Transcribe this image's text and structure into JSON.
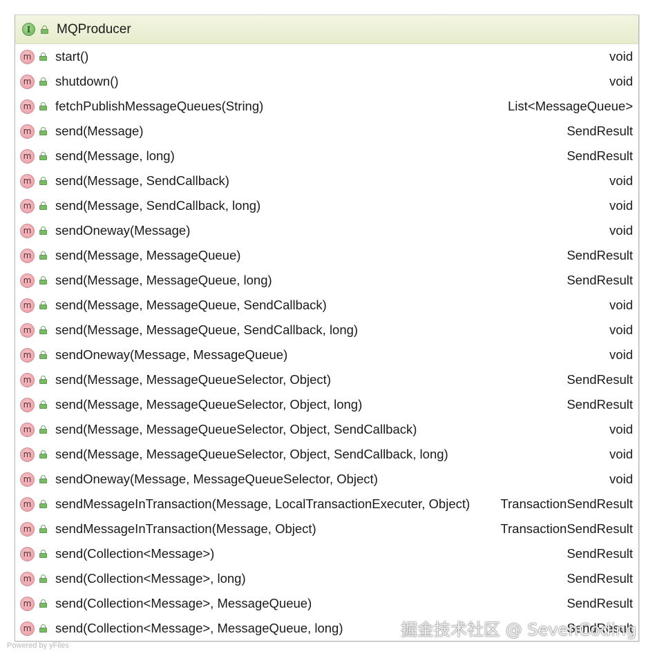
{
  "interface": {
    "badge": "I",
    "name": "MQProducer"
  },
  "method_badge": "m",
  "methods": [
    {
      "signature": "start()",
      "returns": "void"
    },
    {
      "signature": "shutdown()",
      "returns": "void"
    },
    {
      "signature": "fetchPublishMessageQueues(String)",
      "returns": "List<MessageQueue>"
    },
    {
      "signature": "send(Message)",
      "returns": "SendResult"
    },
    {
      "signature": "send(Message, long)",
      "returns": "SendResult"
    },
    {
      "signature": "send(Message, SendCallback)",
      "returns": "void"
    },
    {
      "signature": "send(Message, SendCallback, long)",
      "returns": "void"
    },
    {
      "signature": "sendOneway(Message)",
      "returns": "void"
    },
    {
      "signature": "send(Message, MessageQueue)",
      "returns": "SendResult"
    },
    {
      "signature": "send(Message, MessageQueue, long)",
      "returns": "SendResult"
    },
    {
      "signature": "send(Message, MessageQueue, SendCallback)",
      "returns": "void"
    },
    {
      "signature": "send(Message, MessageQueue, SendCallback, long)",
      "returns": "void"
    },
    {
      "signature": "sendOneway(Message, MessageQueue)",
      "returns": "void"
    },
    {
      "signature": "send(Message, MessageQueueSelector, Object)",
      "returns": "SendResult"
    },
    {
      "signature": "send(Message, MessageQueueSelector, Object, long)",
      "returns": "SendResult"
    },
    {
      "signature": "send(Message, MessageQueueSelector, Object, SendCallback)",
      "returns": "void"
    },
    {
      "signature": "send(Message, MessageQueueSelector, Object, SendCallback, long)",
      "returns": "void"
    },
    {
      "signature": "sendOneway(Message, MessageQueueSelector, Object)",
      "returns": "void"
    },
    {
      "signature": "sendMessageInTransaction(Message, LocalTransactionExecuter, Object)",
      "returns": "TransactionSendResult"
    },
    {
      "signature": "sendMessageInTransaction(Message, Object)",
      "returns": "TransactionSendResult"
    },
    {
      "signature": "send(Collection<Message>)",
      "returns": "SendResult"
    },
    {
      "signature": "send(Collection<Message>, long)",
      "returns": "SendResult"
    },
    {
      "signature": "send(Collection<Message>, MessageQueue)",
      "returns": "SendResult"
    },
    {
      "signature": "send(Collection<Message>, MessageQueue, long)",
      "returns": "SendResult"
    }
  ],
  "footer": "Powered by yFiles",
  "watermark": "掘金技术社区 @ SevenCoding",
  "colors": {
    "header_bg": "#e7eccc",
    "interface_icon": "#6bb25a",
    "method_icon": "#e99aa3",
    "lock_icon": "#78bd64",
    "border": "#b5b5b5"
  }
}
